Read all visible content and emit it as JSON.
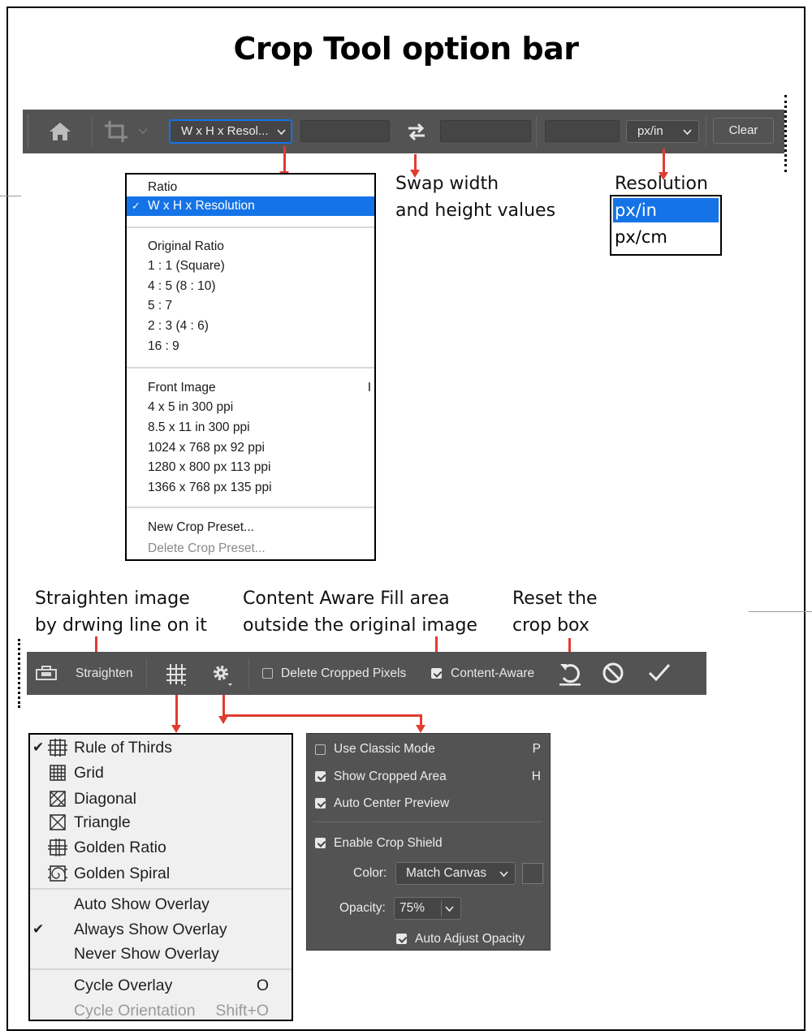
{
  "title": "Crop Tool option bar",
  "top_bar": {
    "preset_label": "W x H x Resol...",
    "unit_label": "px/in",
    "clear_label": "Clear"
  },
  "preset_menu": {
    "items": [
      {
        "label": "Ratio"
      },
      {
        "label": "W x H x Resolution",
        "selected": true
      },
      {
        "label": "Original Ratio"
      },
      {
        "label": "1 : 1 (Square)"
      },
      {
        "label": "4 : 5 (8 : 10)"
      },
      {
        "label": "5 : 7"
      },
      {
        "label": "2 : 3 (4 : 6)"
      },
      {
        "label": "16 : 9"
      },
      {
        "label": "Front Image",
        "shortcut": "I"
      },
      {
        "label": "4 x 5 in 300 ppi"
      },
      {
        "label": "8.5 x 11 in 300 ppi"
      },
      {
        "label": "1024 x 768 px 92 ppi"
      },
      {
        "label": "1280 x 800 px 113 ppi"
      },
      {
        "label": "1366 x 768 px 135 ppi"
      },
      {
        "label": "New Crop Preset..."
      },
      {
        "label": "Delete Crop Preset...",
        "disabled": true
      }
    ]
  },
  "annotations": {
    "swap_line1": "Swap width",
    "swap_line2": "and height values",
    "resolution": "Resolution",
    "straighten_line1": "Straighten image",
    "straighten_line2": "by drwing line on it",
    "content_aware_line1": "Content Aware Fill area",
    "content_aware_line2": "outside the original image",
    "reset_line1": "Reset the",
    "reset_line2": "crop box"
  },
  "resolution_list": [
    "px/in",
    "px/cm"
  ],
  "bottom_bar": {
    "straighten_label": "Straighten",
    "delete_cropped_label": "Delete Cropped Pixels",
    "delete_cropped_checked": false,
    "content_aware_label": "Content-Aware",
    "content_aware_checked": true
  },
  "overlay_menu": {
    "overlays": [
      {
        "label": "Rule of Thirds",
        "checked": true,
        "icon": "rule-of-thirds-icon"
      },
      {
        "label": "Grid",
        "icon": "grid-icon"
      },
      {
        "label": "Diagonal",
        "icon": "diagonal-icon"
      },
      {
        "label": "Triangle",
        "icon": "triangle-icon"
      },
      {
        "label": "Golden Ratio",
        "icon": "golden-ratio-icon"
      },
      {
        "label": "Golden Spiral",
        "icon": "golden-spiral-icon"
      }
    ],
    "show_options": [
      {
        "label": "Auto Show Overlay"
      },
      {
        "label": "Always Show Overlay",
        "checked": true
      },
      {
        "label": "Never Show Overlay"
      }
    ],
    "cycle": [
      {
        "label": "Cycle Overlay",
        "shortcut": "O"
      },
      {
        "label": "Cycle Orientation",
        "shortcut": "Shift+O",
        "disabled": true
      }
    ]
  },
  "settings_panel": {
    "use_classic": {
      "label": "Use Classic Mode",
      "shortcut": "P",
      "checked": false
    },
    "show_cropped": {
      "label": "Show Cropped Area",
      "shortcut": "H",
      "checked": true
    },
    "auto_center": {
      "label": "Auto Center Preview",
      "checked": true
    },
    "enable_shield": {
      "label": "Enable Crop Shield",
      "checked": true
    },
    "color_label": "Color:",
    "color_value": "Match Canvas",
    "opacity_label": "Opacity:",
    "opacity_value": "75%",
    "auto_adjust": {
      "label": "Auto Adjust Opacity",
      "checked": true
    }
  },
  "colors": {
    "bar": "#535353",
    "accent_blue": "#1473e6",
    "arrow_red": "#e03c31"
  }
}
